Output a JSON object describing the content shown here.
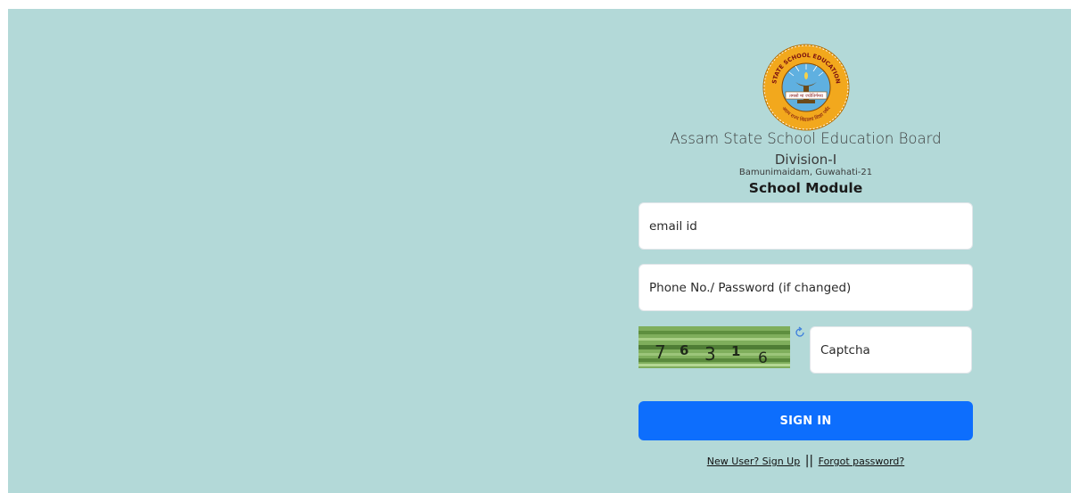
{
  "header": {
    "org_name": "Assam State School Education Board",
    "division": "Division-I",
    "address": "Bamunimaidam, Guwahati-21",
    "module": "School Module"
  },
  "logo": {
    "top_ring_text": "ASSAM STATE SCHOOL EDUCATION BOARD",
    "banner_text": "तमसो मा ज्योतिर्गमय",
    "bottom_ring_text": "असम राज्य विद्यालय शिक्षा पर्षद",
    "ring_color": "#f2a81d",
    "inner_color": "#5fb0e0"
  },
  "form": {
    "email_placeholder": "email id",
    "password_placeholder": "Phone No./ Password (if changed)",
    "captcha_placeholder": "Captcha",
    "captcha_code": [
      "7",
      "6",
      "3",
      "1",
      "6"
    ],
    "signin_label": "SIGN IN",
    "signup_link": "New User? Sign Up",
    "separator": "||",
    "forgot_link": "Forgot password?",
    "refresh_icon": "refresh-icon"
  },
  "colors": {
    "background": "#b3d9d8",
    "primary_button": "#0d6efd",
    "captcha_green": "#6d9b4e"
  }
}
